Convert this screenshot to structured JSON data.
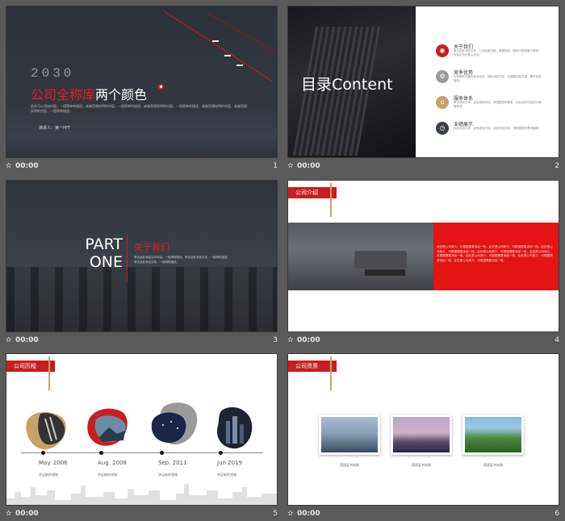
{
  "slides": [
    {
      "time": "00:00",
      "number": "1"
    },
    {
      "time": "00:00",
      "number": "2"
    },
    {
      "time": "00:00",
      "number": "3"
    },
    {
      "time": "00:00",
      "number": "4"
    },
    {
      "time": "00:00",
      "number": "5"
    },
    {
      "time": "00:00",
      "number": "6"
    }
  ],
  "transition_icon": "star-icon",
  "s1": {
    "year": "2030",
    "title_red": "公司全称库",
    "title_white": "两个颜色",
    "desc": "此处可以添加内容，一段简单的描述，或者您想说明的内容，一段简单的描述，或者您想说明的内容，一段简单的描述，或者您想说明的内容，或者您想说明的内容，一段简单描述。",
    "presenter": "演讲人：第一PPT"
  },
  "s2": {
    "toc_title": "目录Content",
    "items": [
      {
        "label": "关于我们",
        "sub": "单击此处添加文本，公司经营范围，简要描述，服务于各类客户需求，目标定位的核心内容。",
        "color": "#c81e1e",
        "icon": "eye-icon"
      },
      {
        "label": "竞争优势",
        "sub": "公司拥有完善的体系结构，团队经验丰富，资源整合能力强，服务优质高效。",
        "color": "#9a9a9a",
        "icon": "gear-icon"
      },
      {
        "label": "服务体系",
        "sub": "单击添加文本，此处添加内容，请根据您的需求，对此处的内容进行编辑修改。",
        "color": "#c8a06a",
        "icon": "lock-icon"
      },
      {
        "label": "业绩展示",
        "sub": "此处添加文本，此处添加内容，此处添加内容，请根据您的需求编辑。",
        "color": "#3a3f4a",
        "icon": "chart-icon"
      }
    ]
  },
  "s3": {
    "part": "PART",
    "one": "ONE",
    "about": "关于我们",
    "desc": "单击此处添加文本内容，一段简短描述，单击此处添加文本，一段简短描述，单击此处添加文本，一段简短描述。"
  },
  "s4": {
    "tag": "公司介绍",
    "text": "此处是公司简介，可根据需要添加一段，此处是公司简介，可根据需要添加一段。此处是公司简介，可根据需要添加一段。此处是公司简介，可根据需要添加一段。此处是公司简介，可根据需要添加一段。此处是公司简介，可根据需要添加一段。此处是公司简介，可根据需要添加一段。此处是公司简介，可根据需要添加一段。"
  },
  "s5": {
    "tag": "公司历程",
    "events": [
      {
        "date": "May. 2006",
        "label": "涉足新的领域"
      },
      {
        "date": "Aug. 2008",
        "label": "涉足新的领域"
      },
      {
        "date": "Sep. 2011",
        "label": "涉足新的领域"
      },
      {
        "date": "Jun 2019",
        "label": "涉足新的领域"
      }
    ]
  },
  "s6": {
    "tag": "公司资质",
    "certs": [
      "资质证书名称",
      "资质证书名称",
      "资质证书名称"
    ]
  }
}
